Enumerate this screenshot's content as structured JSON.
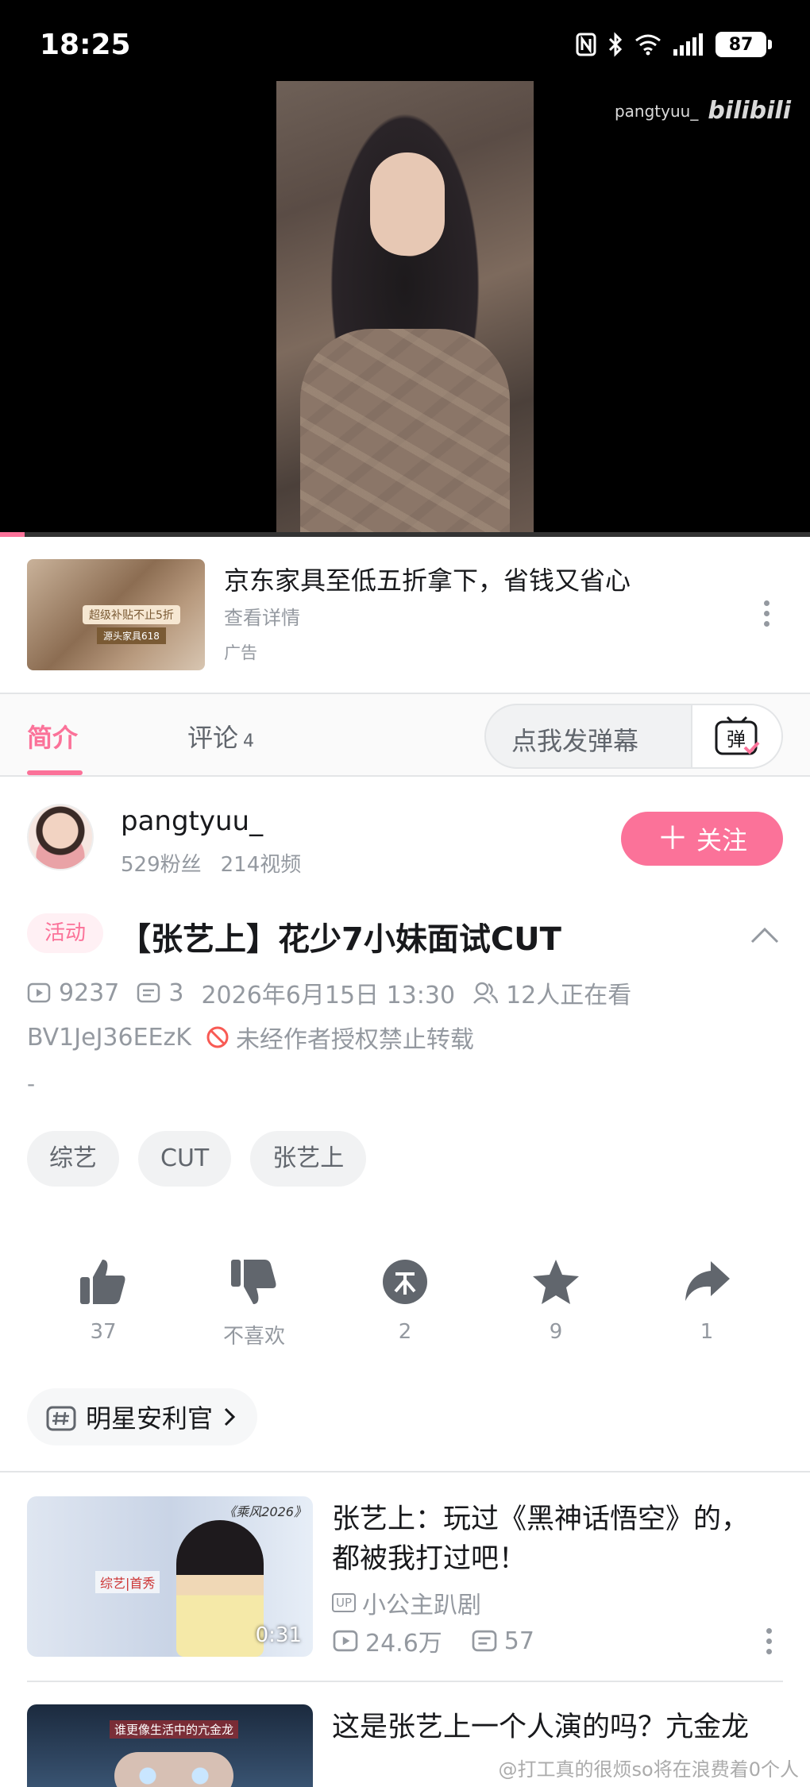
{
  "status_bar": {
    "time": "18:25",
    "battery": "87"
  },
  "player": {
    "watermark_user": "pangtyuu_",
    "watermark_logo": "bilibili",
    "progress": 0.03
  },
  "ad": {
    "title": "京东家具至低五折拿下，省钱又省心",
    "detail": "查看详情",
    "label": "广告",
    "thumb_text": "超级补贴不止5折",
    "thumb_sub": "源头家具618"
  },
  "tabs": {
    "intro": "简介",
    "comments": "评论",
    "comments_count": "4",
    "danmaku_placeholder": "点我发弹幕",
    "danmaku_icon_text": "弹"
  },
  "uploader": {
    "name": "pangtyuu_",
    "fans": "529粉丝",
    "videos": "214视频",
    "follow_label": "关注"
  },
  "video": {
    "badge": "活动",
    "title": "【张艺上】花少7小妹面试CUT",
    "views": "9237",
    "danmaku_count": "3",
    "date": "2026年6月15日 13:30",
    "watching": "12人正在看",
    "bvid": "BV1JeJ36EEzK",
    "copyright": "未经作者授权禁止转载",
    "description": "-",
    "tags": [
      "综艺",
      "CUT",
      "张艺上"
    ]
  },
  "actions": {
    "like": "37",
    "dislike": "不喜欢",
    "coin": "2",
    "favorite": "9",
    "share": "1"
  },
  "topic": {
    "label": "明星安利官"
  },
  "related": [
    {
      "title": "张艺上：玩过《黑神话悟空》的，都被我打过吧！",
      "up": "小公主趴剧",
      "views": "24.6万",
      "danmaku": "57",
      "duration": "0:31",
      "thumb_corner": "《乘风2026》",
      "thumb_tag": "综艺|首秀",
      "up_badge": "UP"
    },
    {
      "title": "这是张艺上一个人演的吗？亢金龙",
      "thumb_caption": "谁更像生活中的亢金龙"
    }
  ],
  "footer_watermark": "@打工真的很烦so将在浪费着0个人",
  "colors": {
    "brand_pink": "#fb7299",
    "text_primary": "#18191c",
    "text_secondary": "#9499a0"
  }
}
